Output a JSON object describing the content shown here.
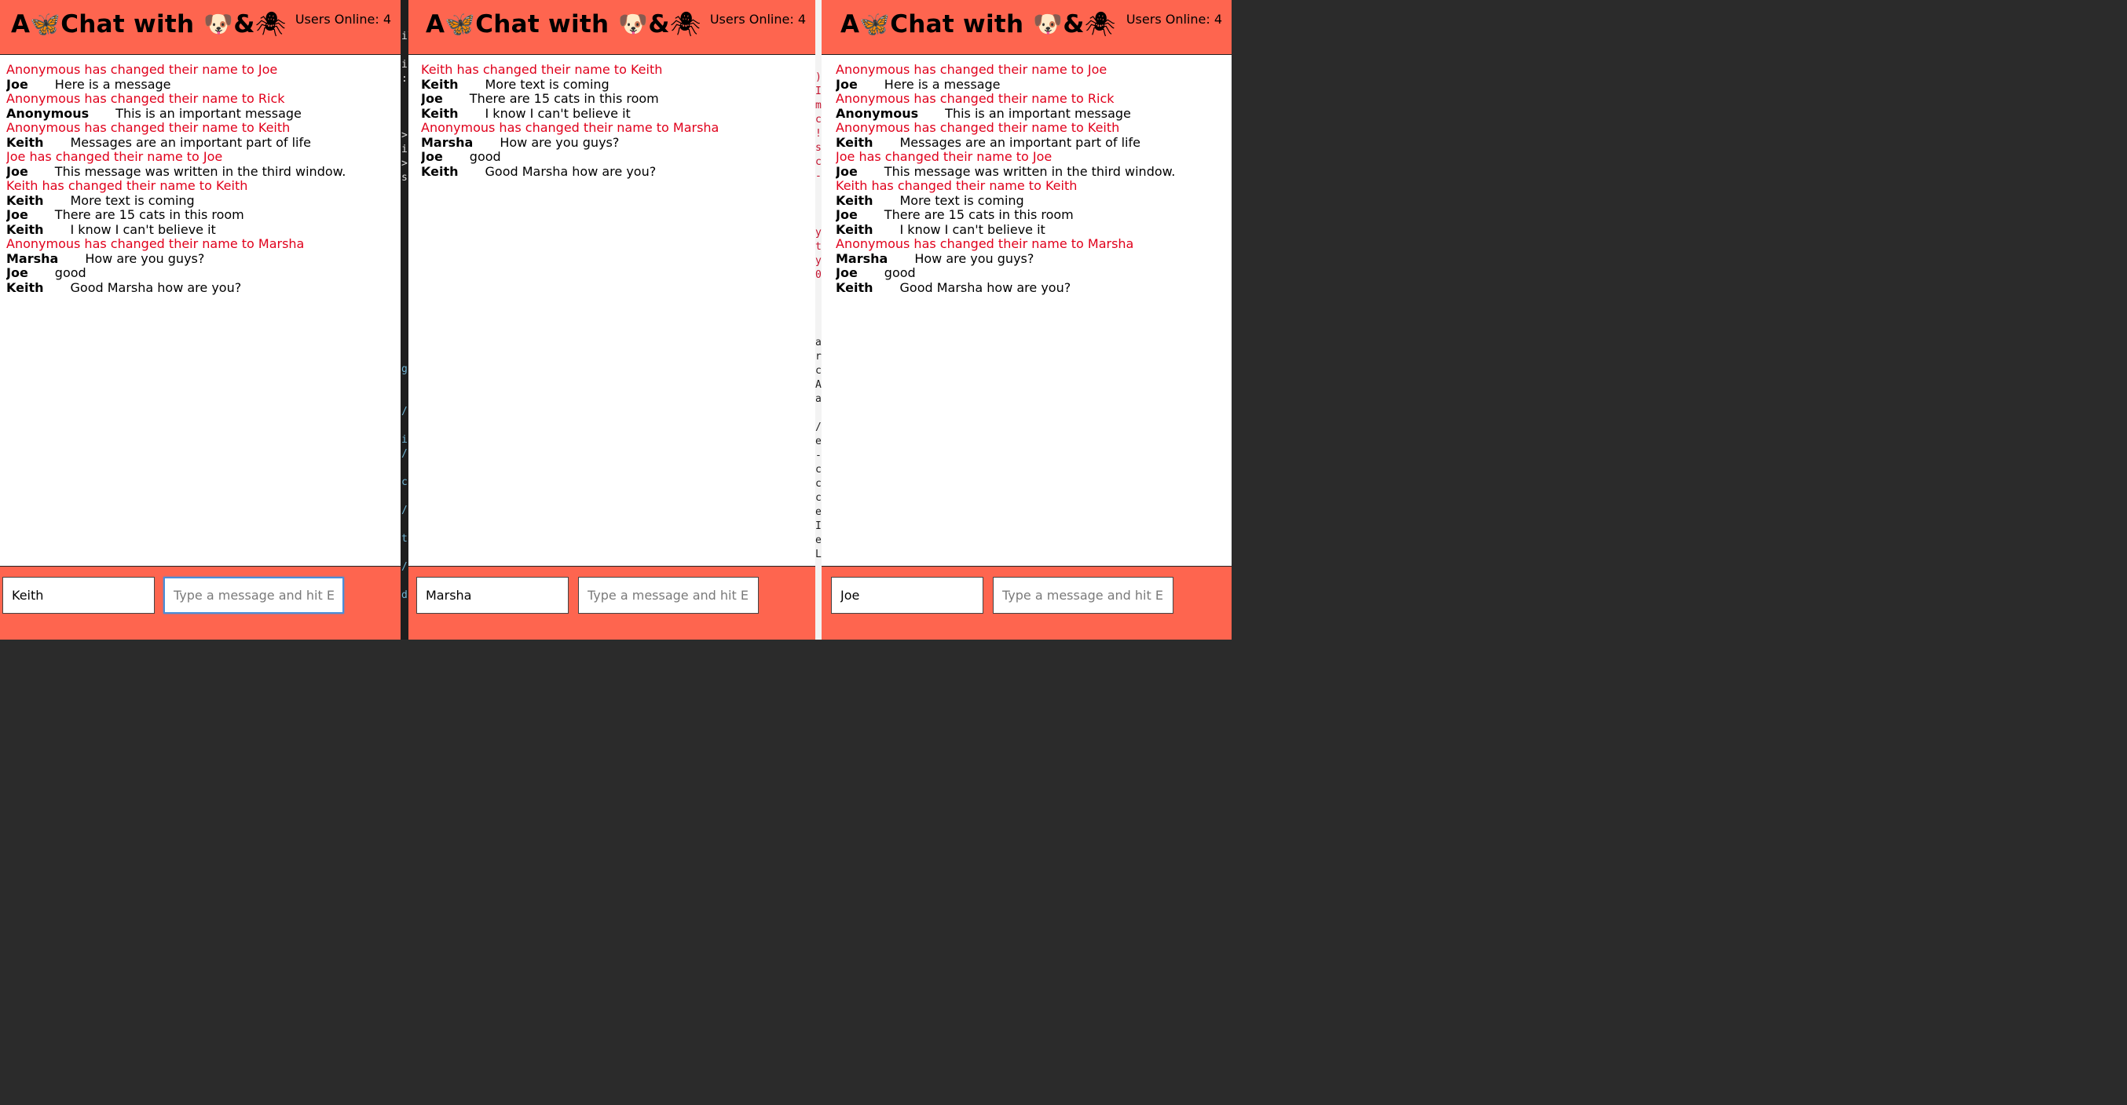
{
  "app": {
    "title_prefix": "A",
    "title_butterfly": "🦋",
    "title_middle": "Chat with ",
    "title_dog": "🐶",
    "title_amp": "&",
    "title_spider": "🕷",
    "accent_color": "#fe654f",
    "system_message_color": "#e0001b"
  },
  "editor_strip": {
    "fragments_a": [
      "il",
      "",
      "i",
      ":",
      "",
      "",
      "",
      ">",
      "i",
      ">",
      "s"
    ],
    "fragments_b": [
      "g",
      "",
      "",
      "/",
      "",
      "i",
      "/",
      "",
      "c",
      "",
      "/",
      "",
      "t",
      "",
      "/",
      "",
      "d"
    ],
    "fragments_c": [
      ")",
      "I",
      "m",
      "c",
      "!",
      "s",
      "c",
      "-",
      "",
      "",
      "",
      "y",
      "t",
      "y",
      "0"
    ],
    "fragments_d": [
      "a",
      "r",
      "c",
      "A",
      "a",
      "",
      "/",
      "e",
      "-",
      "c",
      "c",
      "c",
      "e",
      "I",
      "e",
      "L"
    ]
  },
  "windows": [
    {
      "users_online": "Users Online: 4",
      "name_value": "Keith",
      "message_placeholder": "Type a message and hit EN",
      "messages": [
        {
          "type": "system",
          "text": "Anonymous has changed their name to Joe"
        },
        {
          "type": "chat",
          "author": "Joe",
          "text": "Here is a message"
        },
        {
          "type": "system",
          "text": "Anonymous has changed their name to Rick"
        },
        {
          "type": "chat",
          "author": "Anonymous",
          "text": "This is an important message"
        },
        {
          "type": "system",
          "text": "Anonymous has changed their name to Keith"
        },
        {
          "type": "chat",
          "author": "Keith",
          "text": "Messages are an important part of life"
        },
        {
          "type": "system",
          "text": "Joe has changed their name to Joe"
        },
        {
          "type": "chat",
          "author": "Joe",
          "text": "This message was written in the third window."
        },
        {
          "type": "system",
          "text": "Keith has changed their name to Keith"
        },
        {
          "type": "chat",
          "author": "Keith",
          "text": "More text is coming"
        },
        {
          "type": "chat",
          "author": "Joe",
          "text": "There are 15 cats in this room"
        },
        {
          "type": "chat",
          "author": "Keith",
          "text": "I know I can't believe it"
        },
        {
          "type": "system",
          "text": "Anonymous has changed their name to Marsha"
        },
        {
          "type": "chat",
          "author": "Marsha",
          "text": "How are you guys?"
        },
        {
          "type": "chat",
          "author": "Joe",
          "text": "good"
        },
        {
          "type": "chat",
          "author": "Keith",
          "text": "Good Marsha how are you?"
        }
      ]
    },
    {
      "users_online": "Users Online: 4",
      "name_value": "Marsha",
      "message_placeholder": "Type a message and hit EN",
      "messages": [
        {
          "type": "system",
          "text": "Keith has changed their name to Keith"
        },
        {
          "type": "chat",
          "author": "Keith",
          "text": "More text is coming"
        },
        {
          "type": "chat",
          "author": "Joe",
          "text": "There are 15 cats in this room"
        },
        {
          "type": "chat",
          "author": "Keith",
          "text": "I know I can't believe it"
        },
        {
          "type": "system",
          "text": "Anonymous has changed their name to Marsha"
        },
        {
          "type": "chat",
          "author": "Marsha",
          "text": "How are you guys?"
        },
        {
          "type": "chat",
          "author": "Joe",
          "text": "good"
        },
        {
          "type": "chat",
          "author": "Keith",
          "text": "Good Marsha how are you?"
        }
      ]
    },
    {
      "users_online": "Users Online: 4",
      "name_value": "Joe",
      "message_placeholder": "Type a message and hit EN",
      "messages": [
        {
          "type": "system",
          "text": "Anonymous has changed their name to Joe"
        },
        {
          "type": "chat",
          "author": "Joe",
          "text": "Here is a message"
        },
        {
          "type": "system",
          "text": "Anonymous has changed their name to Rick"
        },
        {
          "type": "chat",
          "author": "Anonymous",
          "text": "This is an important message"
        },
        {
          "type": "system",
          "text": "Anonymous has changed their name to Keith"
        },
        {
          "type": "chat",
          "author": "Keith",
          "text": "Messages are an important part of life"
        },
        {
          "type": "system",
          "text": "Joe has changed their name to Joe"
        },
        {
          "type": "chat",
          "author": "Joe",
          "text": "This message was written in the third window."
        },
        {
          "type": "system",
          "text": "Keith has changed their name to Keith"
        },
        {
          "type": "chat",
          "author": "Keith",
          "text": "More text is coming"
        },
        {
          "type": "chat",
          "author": "Joe",
          "text": "There are 15 cats in this room"
        },
        {
          "type": "chat",
          "author": "Keith",
          "text": "I know I can't believe it"
        },
        {
          "type": "system",
          "text": "Anonymous has changed their name to Marsha"
        },
        {
          "type": "chat",
          "author": "Marsha",
          "text": "How are you guys?"
        },
        {
          "type": "chat",
          "author": "Joe",
          "text": "good"
        },
        {
          "type": "chat",
          "author": "Keith",
          "text": "Good Marsha how are you?"
        }
      ]
    }
  ]
}
